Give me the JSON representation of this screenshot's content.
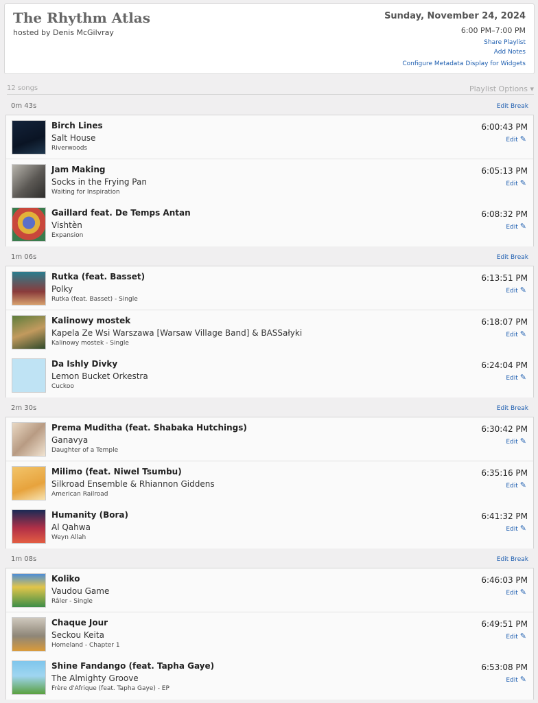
{
  "header": {
    "title": "The Rhythm Atlas",
    "host": "hosted by Denis McGilvray",
    "date": "Sunday, November 24, 2024",
    "time_range": "6:00 PM–7:00 PM",
    "share_playlist": "Share Playlist",
    "add_notes": "Add Notes",
    "configure_metadata": "Configure Metadata Display for Widgets"
  },
  "summary": {
    "song_count": "12 songs",
    "playlist_options": "Playlist Options ▾"
  },
  "labels": {
    "edit": "Edit",
    "edit_break": "Edit Break",
    "edit_icon": "pencil-icon"
  },
  "breaks": [
    {
      "duration": "0m 43s"
    },
    {
      "duration": "1m 06s"
    },
    {
      "duration": "2m 30s"
    },
    {
      "duration": "1m 08s"
    }
  ],
  "groups": [
    {
      "tracks": [
        {
          "title": "Birch Lines",
          "artist": "Salt House",
          "album": "Riverwoods",
          "time": "6:00:43 PM"
        },
        {
          "title": "Jam Making",
          "artist": "Socks in the Frying Pan",
          "album": "Waiting for Inspiration",
          "time": "6:05:13 PM"
        },
        {
          "title": "Gaillard feat. De Temps Antan",
          "artist": "Vishtèn",
          "album": "Expansion",
          "time": "6:08:32 PM"
        }
      ]
    },
    {
      "tracks": [
        {
          "title": "Rutka (feat. Basset)",
          "artist": "Polky",
          "album": "Rutka (feat. Basset) - Single",
          "time": "6:13:51 PM"
        },
        {
          "title": "Kalinowy mostek",
          "artist": "Kapela Ze Wsi Warszawa [Warsaw Village Band] & BASSałyki",
          "album": "Kalinowy mostek - Single",
          "time": "6:18:07 PM"
        },
        {
          "title": "Da Ishly Divky",
          "artist": "Lemon Bucket Orkestra",
          "album": "Cuckoo",
          "time": "6:24:04 PM"
        }
      ]
    },
    {
      "tracks": [
        {
          "title": "Prema Muditha (feat. Shabaka Hutchings)",
          "artist": "Ganavya",
          "album": "Daughter of a Temple",
          "time": "6:30:42 PM"
        },
        {
          "title": "Milimo (feat. Niwel Tsumbu)",
          "artist": "Silkroad Ensemble & Rhiannon Giddens",
          "album": "American Railroad",
          "time": "6:35:16 PM"
        },
        {
          "title": "Humanity (Bora)",
          "artist": "Al Qahwa",
          "album": "Weyn Allah",
          "time": "6:41:32 PM"
        }
      ]
    },
    {
      "tracks": [
        {
          "title": "Koliko",
          "artist": "Vaudou Game",
          "album": "Râler - Single",
          "time": "6:46:03 PM"
        },
        {
          "title": "Chaque Jour",
          "artist": "Seckou Keita",
          "album": "Homeland - Chapter 1",
          "time": "6:49:51 PM"
        },
        {
          "title": "Shine Fandango (feat. Tapha Gaye)",
          "artist": "The Almighty Groove",
          "album": "Frère d'Afrique (feat. Tapha Gaye) - EP",
          "time": "6:53:08 PM"
        }
      ]
    }
  ]
}
